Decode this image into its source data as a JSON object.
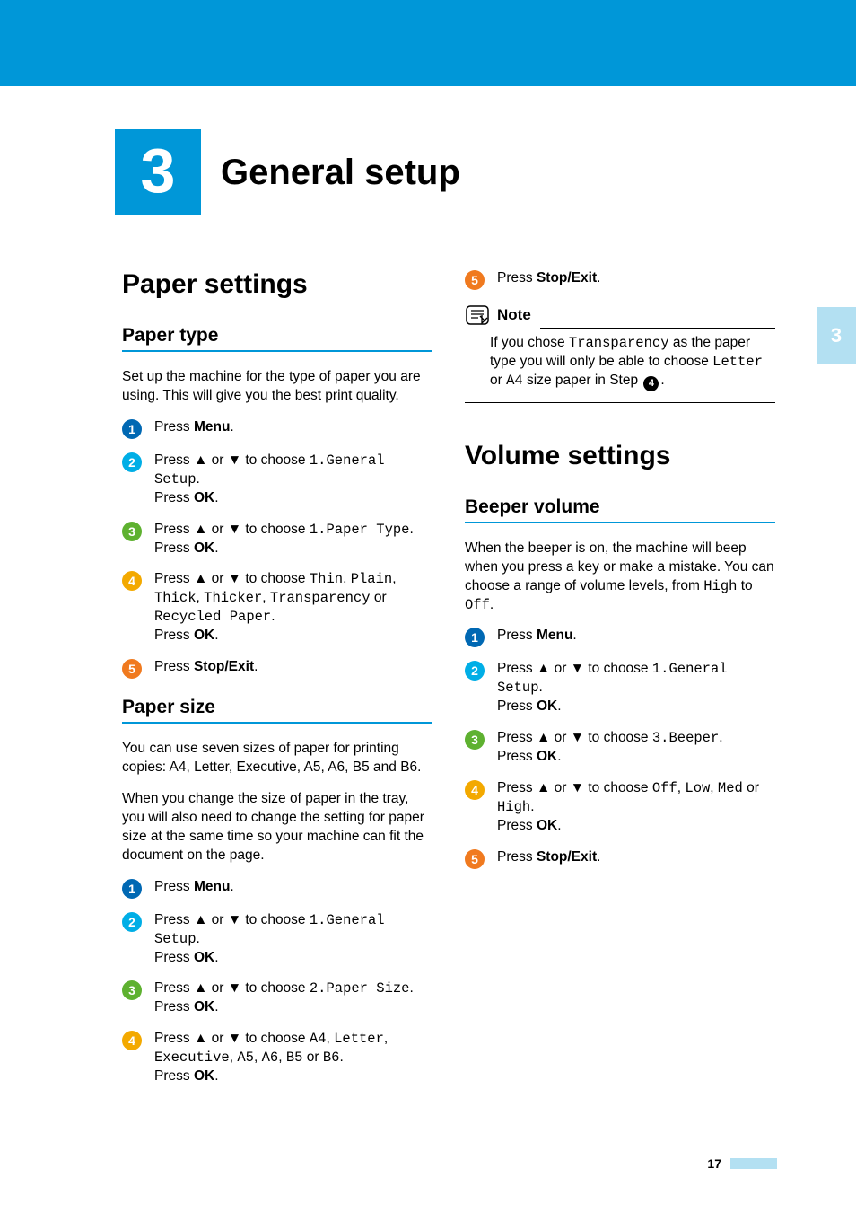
{
  "chapter": {
    "number": "3",
    "title": "General setup"
  },
  "side_tab": "3",
  "page_number": "17",
  "left": {
    "h1": "Paper settings",
    "paper_type": {
      "heading": "Paper type",
      "intro": "Set up the machine for the type of paper you are using. This will give you the best print quality.",
      "s1_a": "Press ",
      "s1_b": "Menu",
      "s1_c": ".",
      "s2_a": "Press ",
      "s2_b": " or ",
      "s2_c": " to choose ",
      "s2_d": "1.General Setup",
      "s2_e": ".",
      "s2_f": "Press ",
      "s2_g": "OK",
      "s2_h": ".",
      "s3_a": "Press ",
      "s3_b": " or ",
      "s3_c": " to choose ",
      "s3_d": "1.Paper Type",
      "s3_e": ".",
      "s3_f": "Press ",
      "s3_g": "OK",
      "s3_h": ".",
      "s4_a": "Press ",
      "s4_b": " or ",
      "s4_c": " to choose ",
      "s4_opt1": "Thin",
      "s4_c1": ", ",
      "s4_opt2": "Plain",
      "s4_c2": ", ",
      "s4_opt3": "Thick",
      "s4_c3": ", ",
      "s4_opt4": "Thicker",
      "s4_c4": ", ",
      "s4_opt5": "Transparency",
      "s4_or": " or ",
      "s4_opt6": "Recycled Paper",
      "s4_e": ".",
      "s4_f": "Press ",
      "s4_g": "OK",
      "s4_h": ".",
      "s5_a": "Press ",
      "s5_b": "Stop/Exit",
      "s5_c": "."
    },
    "paper_size": {
      "heading": "Paper size",
      "intro1": "You can use seven sizes of paper for printing copies: A4, Letter,  Executive, A5, A6, B5 and B6.",
      "intro2": "When you change the size of paper in the tray, you will also need to change the setting for paper size at the same time so your machine can fit the document on the page.",
      "s1_a": "Press ",
      "s1_b": "Menu",
      "s1_c": ".",
      "s2_a": "Press ",
      "s2_b": " or ",
      "s2_c": " to choose ",
      "s2_d": "1.General Setup",
      "s2_e": ".",
      "s2_f": "Press ",
      "s2_g": "OK",
      "s2_h": ".",
      "s3_a": "Press ",
      "s3_b": " or ",
      "s3_c": " to choose ",
      "s3_d": "2.Paper Size",
      "s3_e": ".",
      "s3_f": "Press ",
      "s3_g": "OK",
      "s3_h": ".",
      "s4_a": "Press ",
      "s4_b": " or ",
      "s4_c": " to choose ",
      "s4_opt1": "A4",
      "s4_c1": ", ",
      "s4_opt2": "Letter",
      "s4_c2": ", ",
      "s4_opt3": "Executive",
      "s4_c3": ", ",
      "s4_opt4": "A5",
      "s4_c4": ", ",
      "s4_opt5": "A6",
      "s4_c5": ", ",
      "s4_opt6": "B5",
      "s4_or": " or ",
      "s4_opt7": "B6",
      "s4_e": ".",
      "s4_f": "Press ",
      "s4_g": "OK",
      "s4_h": "."
    }
  },
  "right": {
    "s5_a": "Press ",
    "s5_b": "Stop/Exit",
    "s5_c": ".",
    "note_label": "Note",
    "note_a": "If you chose ",
    "note_b": "Transparency",
    "note_c": " as the paper type you will only be able to choose ",
    "note_d": "Letter",
    "note_e": " or ",
    "note_f": "A4",
    "note_g": " size paper in Step ",
    "note_ref": "4",
    "note_h": ".",
    "h1": "Volume settings",
    "beeper": {
      "heading": "Beeper volume",
      "intro_a": "When the beeper is on, the machine will beep when you press a key or make a mistake. You can choose a range of volume levels, from ",
      "intro_b": "High",
      "intro_c": " to ",
      "intro_d": "Off",
      "intro_e": ".",
      "s1_a": "Press ",
      "s1_b": "Menu",
      "s1_c": ".",
      "s2_a": "Press ",
      "s2_b": " or ",
      "s2_c": " to choose ",
      "s2_d": "1.General Setup",
      "s2_e": ".",
      "s2_f": "Press ",
      "s2_g": "OK",
      "s2_h": ".",
      "s3_a": "Press ",
      "s3_b": " or ",
      "s3_c": " to choose ",
      "s3_d": "3.Beeper",
      "s3_e": ".",
      "s3_f": "Press ",
      "s3_g": "OK",
      "s3_h": ".",
      "s4_a": "Press ",
      "s4_b": " or ",
      "s4_c": " to choose ",
      "s4_opt1": "Off",
      "s4_c1": ", ",
      "s4_opt2": "Low",
      "s4_c2": ", ",
      "s4_opt3": "Med",
      "s4_or": " or ",
      "s4_opt4": "High",
      "s4_e": ".",
      "s4_f": "Press ",
      "s4_g": "OK",
      "s4_h": ".",
      "s5_a": "Press ",
      "s5_b": "Stop/Exit",
      "s5_c": "."
    }
  }
}
